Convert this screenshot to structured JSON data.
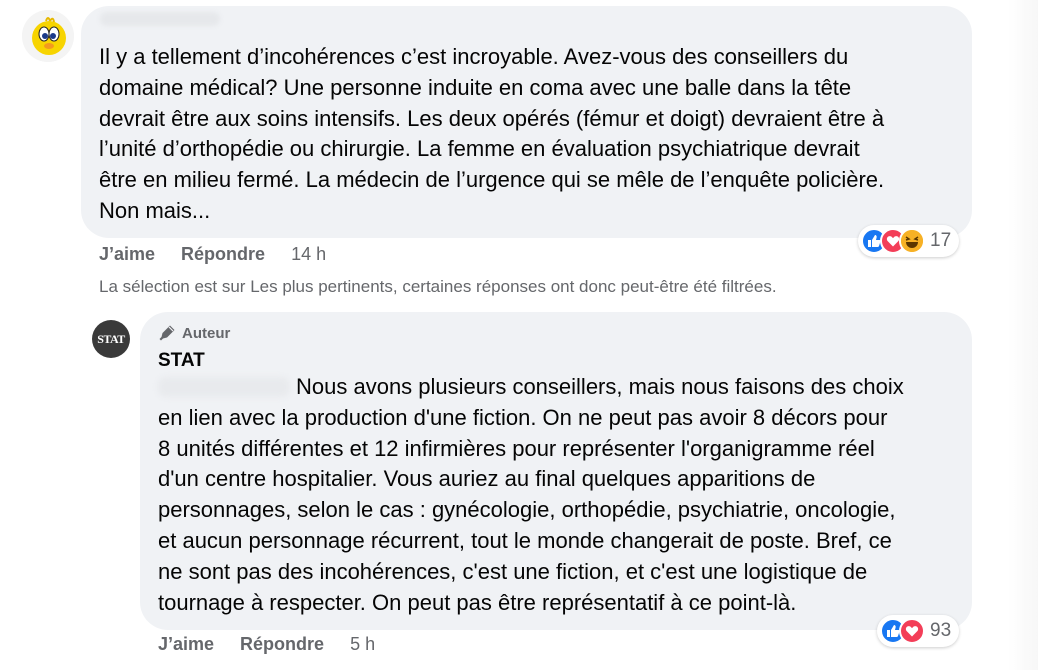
{
  "comment1": {
    "text": "Il y a tellement d’incohérences c’est incroyable. Avez-vous des conseillers du\ndomaine médical? Une personne induite en coma avec une balle dans la tête\ndevrait être aux soins intensifs. Les deux opérés (fémur et doigt) devraient être à\nl’unité d’orthopédie ou chirurgie. La femme en évaluation psychiatrique devrait\nêtre en milieu fermé. La médecin de l’urgence qui se mêle de l’enquête policière.\nNon mais...",
    "like_label": "J’aime",
    "reply_label": "Répondre",
    "time": "14 h",
    "reaction_count": "17",
    "reaction_icons": [
      "like-icon",
      "love-icon",
      "haha-icon"
    ]
  },
  "filter_notice": "La sélection est sur Les plus pertinents, certaines réponses ont donc peut-être été filtrées.",
  "reply": {
    "author_badge": "Auteur",
    "author_name": "STAT",
    "avatar_text": "STAT",
    "text": "Nous avons plusieurs conseillers, mais nous faisons des choix\nen lien avec la production d'une fiction. On ne peut pas avoir 8 décors pour\n8 unités différentes et 12 infirmières pour représenter l'organigramme réel\nd'un centre hospitalier. Vous auriez au final quelques apparitions de\npersonnages, selon le cas : gynécologie, orthopédie, psychiatrie, oncologie,\net aucun personnage récurrent, tout le monde changerait de poste. Bref, ce\nne sont pas des incohérences, c'est une fiction, et c'est une logistique de\ntournage à respecter. On peut pas être représentatif à ce point-là.",
    "like_label": "J’aime",
    "reply_label": "Répondre",
    "time": "5 h",
    "reaction_count": "93",
    "reaction_icons": [
      "like-icon",
      "love-icon"
    ]
  },
  "colors": {
    "bubble": "#f0f2f5",
    "secondary_text": "#65676b",
    "like": "#1877f2",
    "love": "#f33e58",
    "haha": "#f7b125"
  }
}
